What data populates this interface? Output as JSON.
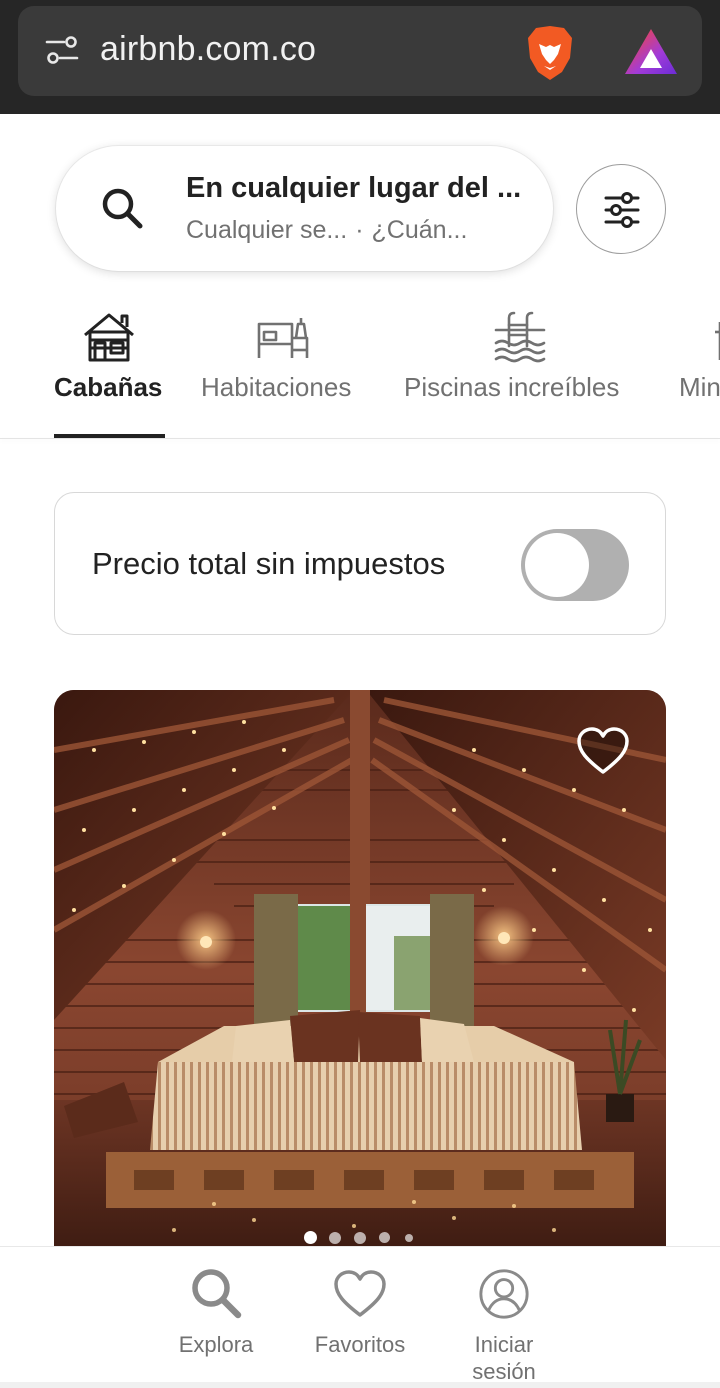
{
  "browser": {
    "url": "airbnb.com.co",
    "icons": [
      "site-settings-icon",
      "brave-lion-icon",
      "brave-rewards-icon"
    ]
  },
  "search": {
    "title": "En cualquier lugar del ...",
    "sub_when": "Cualquier se...",
    "separator": "·",
    "sub_who": "¿Cuán..."
  },
  "categories": [
    {
      "label": "Cabañas",
      "icon": "cabin-icon",
      "active": true
    },
    {
      "label": "Habitaciones",
      "icon": "room-bed-icon",
      "active": false
    },
    {
      "label": "Piscinas increíbles",
      "icon": "pool-icon",
      "active": false
    },
    {
      "label": "Min",
      "icon": "minsus-icon",
      "active": false
    }
  ],
  "price_toggle": {
    "label": "Precio total sin impuestos",
    "on": false
  },
  "listing": {
    "photo": "cabin-attic-bedroom-photo",
    "favorite": false,
    "photo_count": 5,
    "current_photo": 1
  },
  "bottom_nav": [
    {
      "label": "Explora",
      "icon": "search-icon",
      "active": false
    },
    {
      "label": "Favoritos",
      "icon": "heart-icon",
      "active": false
    },
    {
      "label_line1": "Iniciar",
      "label_line2": "sesión",
      "icon": "profile-icon",
      "active": false
    }
  ],
  "colors": {
    "text": "#222222",
    "muted": "#717171",
    "toggle_off": "#b0b0b0",
    "browser_bar": "#262626"
  }
}
